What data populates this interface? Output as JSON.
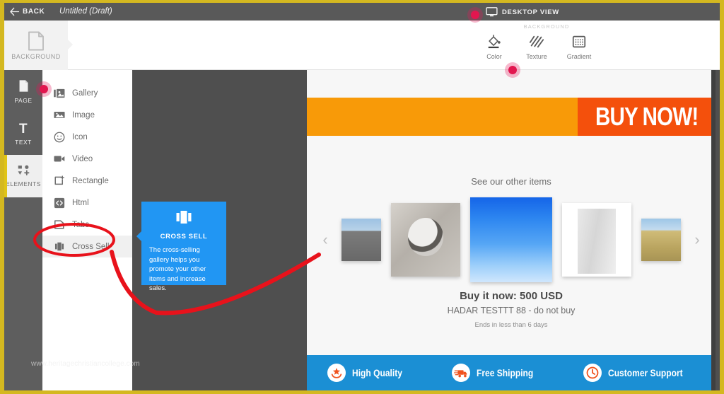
{
  "topbar": {
    "back_label": "BACK",
    "back_icon": "arrow-left-icon",
    "document_title": "Untitled (Draft)",
    "view_mode": "DESKTOP VIEW",
    "view_icon": "monitor-icon"
  },
  "toolpanel": {
    "tab_label": "BACKGROUND",
    "tab_icon": "page-icon",
    "group_title": "BACKGROUND",
    "tools": [
      {
        "label": "Color",
        "icon": "paint-bucket-icon"
      },
      {
        "label": "Texture",
        "icon": "hatch-lines-icon"
      },
      {
        "label": "Gradient",
        "icon": "gradient-dots-icon"
      }
    ]
  },
  "rail": {
    "items": [
      {
        "label": "PAGE",
        "icon": "page-icon",
        "active": false
      },
      {
        "label": "TEXT",
        "icon": "text-t-icon",
        "active": false
      },
      {
        "label": "ELEMENTS",
        "icon": "elements-icon",
        "active": true
      }
    ]
  },
  "elements_list": {
    "items": [
      {
        "label": "Gallery",
        "icon": "gallery-icon"
      },
      {
        "label": "Image",
        "icon": "image-icon"
      },
      {
        "label": "Icon",
        "icon": "smiley-icon"
      },
      {
        "label": "Video",
        "icon": "video-camera-icon"
      },
      {
        "label": "Rectangle",
        "icon": "rectangle-plus-icon"
      },
      {
        "label": "Html",
        "icon": "code-icon"
      },
      {
        "label": "Tabs",
        "icon": "tabs-icon"
      },
      {
        "label": "Cross Sell",
        "icon": "cross-sell-icon"
      }
    ],
    "highlighted": "Cross Sell"
  },
  "tooltip": {
    "icon": "cross-sell-icon",
    "title": "CROSS SELL",
    "body": "The cross-selling gallery helps you promote your other items and increase sales.",
    "background_color": "#2196f3"
  },
  "canvas": {
    "banner": {
      "cta_text": "BUY NOW!",
      "left_color": "#f89a08",
      "right_color": "#f4500c"
    },
    "cross_sell": {
      "heading": "See our other items",
      "prev_arrow": "chevron-left-icon",
      "next_arrow": "chevron-right-icon",
      "thumbnails": [
        {
          "alt": "race cars on track",
          "size": "small"
        },
        {
          "alt": "coffee cup on saucer",
          "size": "mid"
        },
        {
          "alt": "blue sky with clouds",
          "size": "big"
        },
        {
          "alt": "grey sweatpants",
          "size": "mid"
        },
        {
          "alt": "dirt path through field",
          "size": "small"
        }
      ]
    },
    "listing": {
      "price_line": "Buy it now: 500 USD",
      "item_title": "HADAR TESTTT 88 - do not buy",
      "time_left": "Ends in less than 6 days"
    },
    "features": {
      "background_color": "#1b8fd4",
      "items": [
        {
          "label": "High Quality",
          "icon": "star-hands-icon"
        },
        {
          "label": "Free Shipping",
          "icon": "delivery-truck-icon"
        },
        {
          "label": "Customer Support",
          "icon": "clock-icon"
        }
      ]
    }
  },
  "watermark": {
    "text": "www.heritagechristiancollege.com"
  },
  "annotations": {
    "ellipse_target": "Cross Sell",
    "arrow_color": "#e8121b",
    "click_markers": [
      {
        "name": "click-marker-desktop-view"
      },
      {
        "name": "click-marker-texture"
      },
      {
        "name": "click-marker-elements"
      }
    ]
  }
}
